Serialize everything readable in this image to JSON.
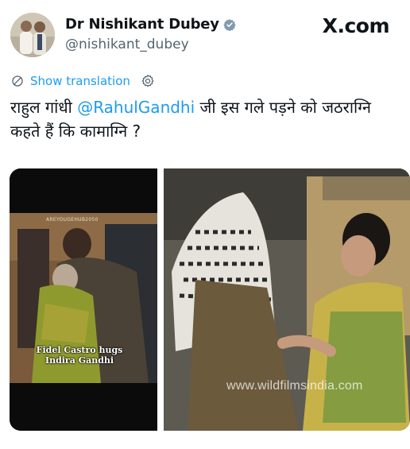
{
  "author": {
    "display_name": "Dr Nishikant Dubey",
    "handle": "@nishikant_dubey",
    "verified": true
  },
  "brand": "X.com",
  "translate": {
    "label": "Show translation"
  },
  "tweet": {
    "text_before": "राहुल गांधी ",
    "mention": "@RahulGandhi",
    "text_after": " जी इस गले पड़ने को जठराग्नि कहते हैं कि कामाग्नि ?"
  },
  "media": {
    "left": {
      "top_watermark": "AREYOUGEHUB2050",
      "caption_line1": "Fidel Castro hugs",
      "caption_line2": "Indira Gandhi"
    },
    "right": {
      "watermark": "www.wildfilmsindia.com"
    }
  },
  "colors": {
    "link": "#1d9bf0",
    "text": "#0f1419",
    "secondary": "#536471",
    "verified": "#829aab"
  }
}
